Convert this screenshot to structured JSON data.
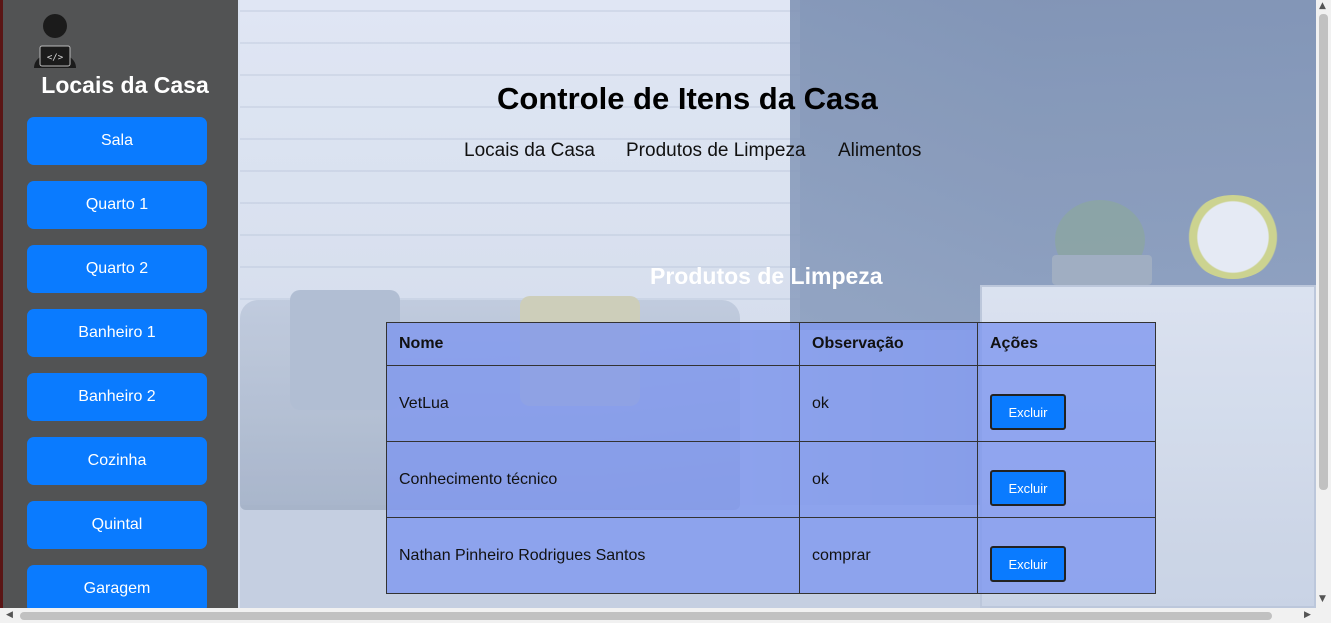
{
  "sidebar": {
    "title": "Locais da Casa",
    "icon": "user-laptop-icon",
    "items": [
      {
        "label": "Sala"
      },
      {
        "label": "Quarto 1"
      },
      {
        "label": "Quarto 2"
      },
      {
        "label": "Banheiro 1"
      },
      {
        "label": "Banheiro 2"
      },
      {
        "label": "Cozinha"
      },
      {
        "label": "Quintal"
      },
      {
        "label": "Garagem"
      }
    ]
  },
  "header": {
    "title": "Controle de Itens da Casa",
    "nav": [
      {
        "label": "Locais da Casa"
      },
      {
        "label": "Produtos de Limpeza"
      },
      {
        "label": "Alimentos"
      }
    ]
  },
  "section": {
    "title": "Produtos de Limpeza"
  },
  "table": {
    "headers": {
      "name": "Nome",
      "note": "Observação",
      "actions": "Ações"
    },
    "rows": [
      {
        "name": "VetLua",
        "note": "ok",
        "action": "Excluir"
      },
      {
        "name": "Conhecimento técnico",
        "note": "ok",
        "action": "Excluir"
      },
      {
        "name": "Nathan Pinheiro Rodrigues Santos",
        "note": "comprar",
        "action": "Excluir"
      }
    ]
  },
  "colors": {
    "accent": "#0a7bff",
    "sidebar_bg": "#464646",
    "table_bg": "#7d96f0"
  }
}
